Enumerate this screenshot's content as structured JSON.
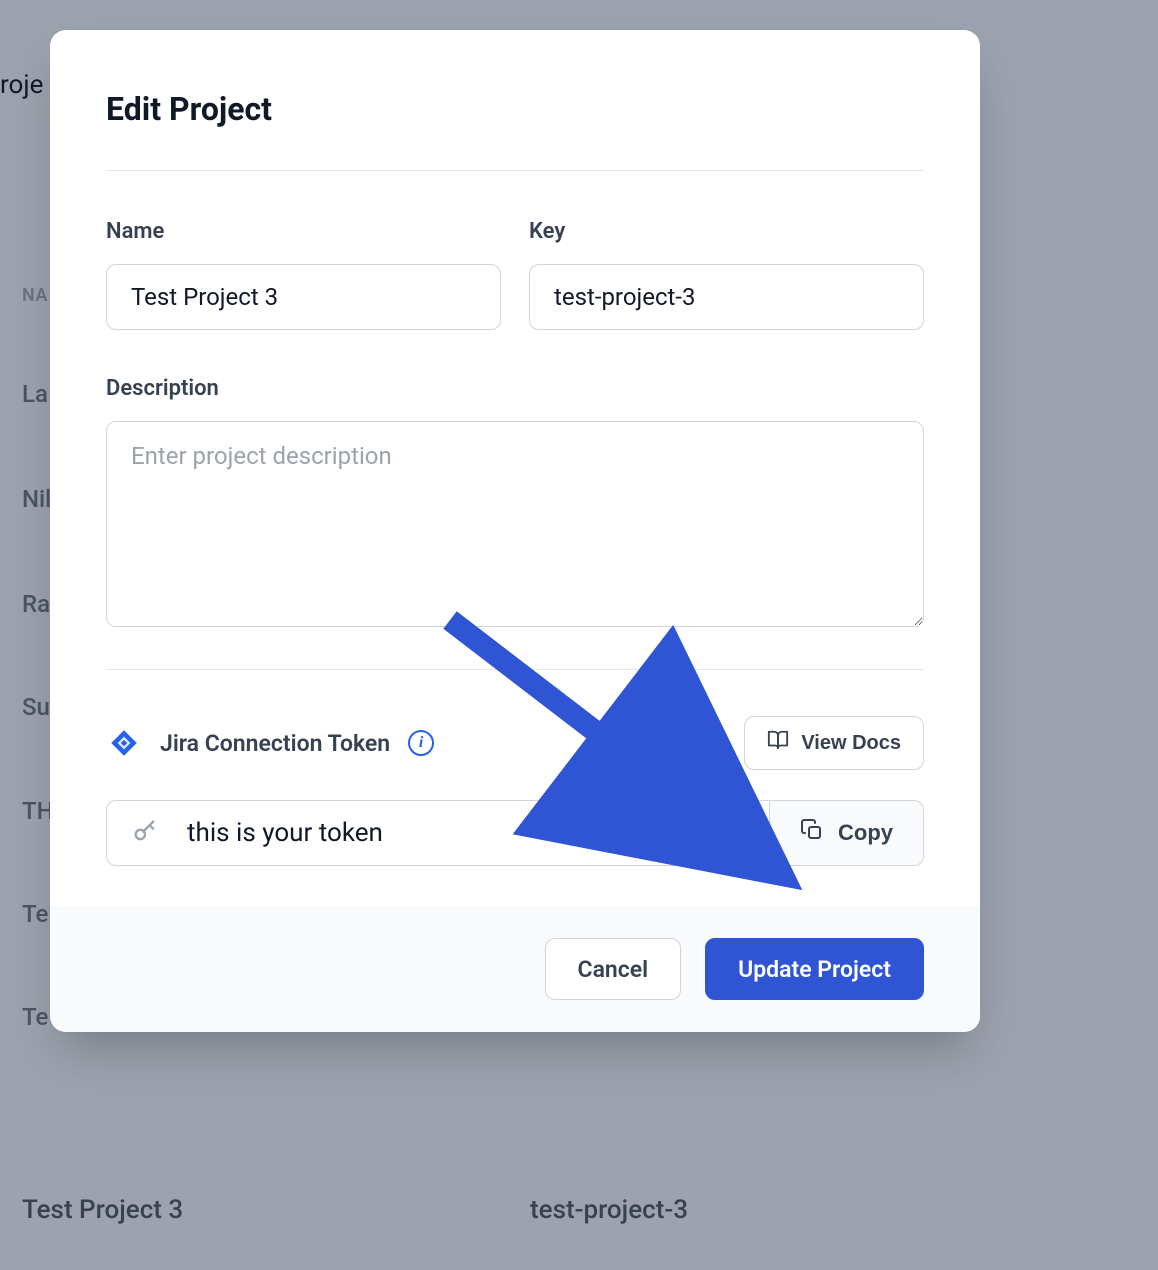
{
  "background": {
    "header_fragment": "roje",
    "col_header": "NA",
    "rows": [
      "La",
      "Nil",
      "Ra",
      "Su",
      "TH",
      "Te",
      "Te"
    ],
    "bottom": {
      "name": "Test Project 3",
      "key": "test-project-3"
    }
  },
  "modal": {
    "title": "Edit Project",
    "fields": {
      "name": {
        "label": "Name",
        "value": "Test Project 3"
      },
      "key": {
        "label": "Key",
        "value": "test-project-3"
      },
      "description": {
        "label": "Description",
        "placeholder": "Enter project description",
        "value": ""
      }
    },
    "jira": {
      "label": "Jira Connection Token",
      "view_docs": "View Docs",
      "token_value": "this is your token",
      "copy_label": "Copy"
    },
    "actions": {
      "cancel": "Cancel",
      "submit": "Update Project"
    }
  }
}
